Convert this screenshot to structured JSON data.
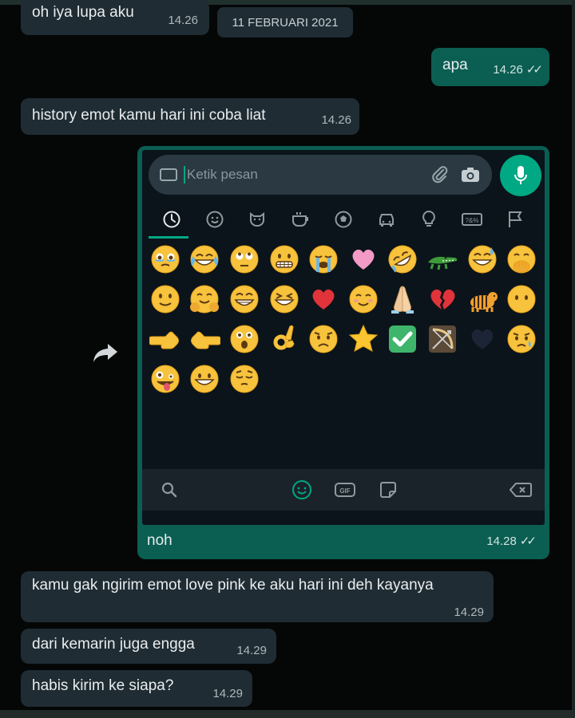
{
  "messages": [
    {
      "text": "oh iya lupa aku",
      "time": "14.26"
    },
    {
      "text": "apa",
      "time": "14.26"
    },
    {
      "text": "history emot kamu hari ini coba liat",
      "time": "14.26"
    },
    {
      "text": "kamu gak ngirim emot love pink ke aku hari ini deh kayanya",
      "time": "14.29"
    },
    {
      "text": "dari kemarin juga engga",
      "time": "14.29"
    },
    {
      "text": "habis kirim ke siapa?",
      "time": "14.29"
    }
  ],
  "date_chip": "11 FEBRUARI 2021",
  "image_message": {
    "caption": "noh",
    "time": "14.28",
    "composer_placeholder": "Ketik pesan"
  },
  "ticks": "✓✓",
  "colors": {
    "incoming_bubble": "#1f2c33",
    "outgoing_bubble": "#0b5e52",
    "accent": "#00a884",
    "background": "#050707"
  },
  "emoji_categories": [
    "recent-icon",
    "smiley-icon",
    "animal-icon",
    "food-icon",
    "activity-icon",
    "travel-icon",
    "objects-icon",
    "symbols-icon",
    "flags-icon"
  ],
  "recent_emojis": [
    "face-holding-back-tears",
    "face-with-tears-of-joy",
    "face-with-rolling-eyes",
    "grimacing-face",
    "loudly-crying-face",
    "pink-heart",
    "rolling-on-floor-laughing",
    "crocodile",
    "grinning-face-with-sweat",
    "face-with-hand-over-mouth",
    "slightly-smiling-face",
    "smiling-face-with-open-hands",
    "beaming-face",
    "grinning-squinting-face",
    "red-heart",
    "smiling-face",
    "folded-hands",
    "broken-heart",
    "tiger",
    "face-without-mouth",
    "backhand-index-pointing-left",
    "backhand-index-pointing-right",
    "astonished-face",
    "ok-hand",
    "worried-face",
    "star",
    "check-mark-button",
    "bow-and-arrow",
    "black-heart",
    "sad-but-relieved-face",
    "zany-face",
    "grinning-face",
    "pensive-face"
  ]
}
